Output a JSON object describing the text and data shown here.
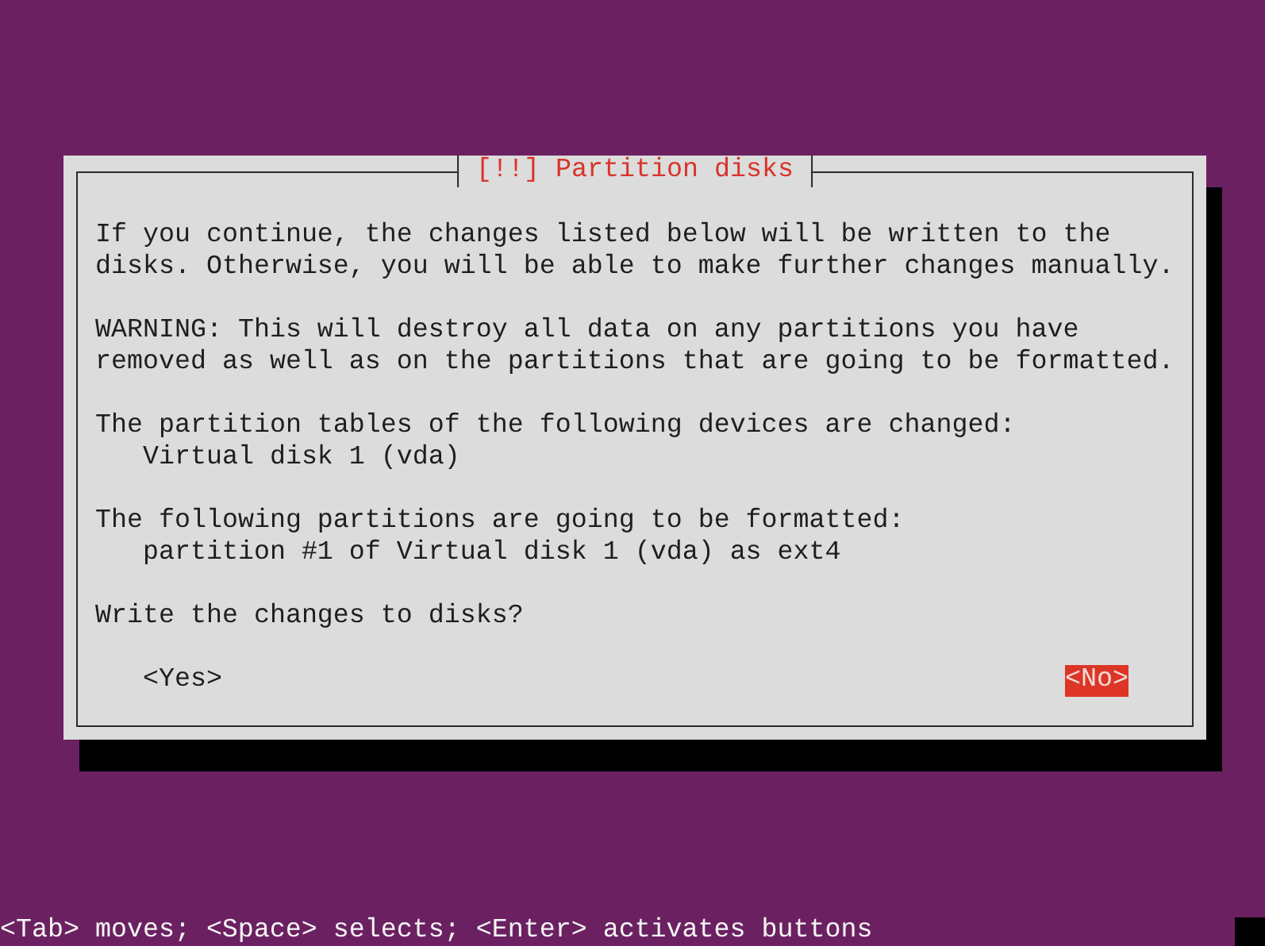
{
  "dialog": {
    "title": "[!!] Partition disks",
    "sections": [
      {
        "text": "If you continue, the changes listed below will be written to the disks. Otherwise, you will be able to make further changes manually."
      },
      {
        "text": "WARNING: This will destroy all data on any partitions you have removed as well as on the partitions that are going to be formatted."
      },
      {
        "text": "The partition tables of the following devices are changed:",
        "items": [
          "Virtual disk 1 (vda)"
        ]
      },
      {
        "text": "The following partitions are going to be formatted:",
        "items": [
          "partition #1 of Virtual disk 1 (vda) as ext4"
        ]
      },
      {
        "text": "Write the changes to disks?"
      }
    ],
    "buttons": [
      {
        "label": "<Yes>",
        "selected": false
      },
      {
        "label": "<No>",
        "selected": true
      }
    ]
  },
  "status_bar": "<Tab> moves; <Space> selects; <Enter> activates buttons"
}
